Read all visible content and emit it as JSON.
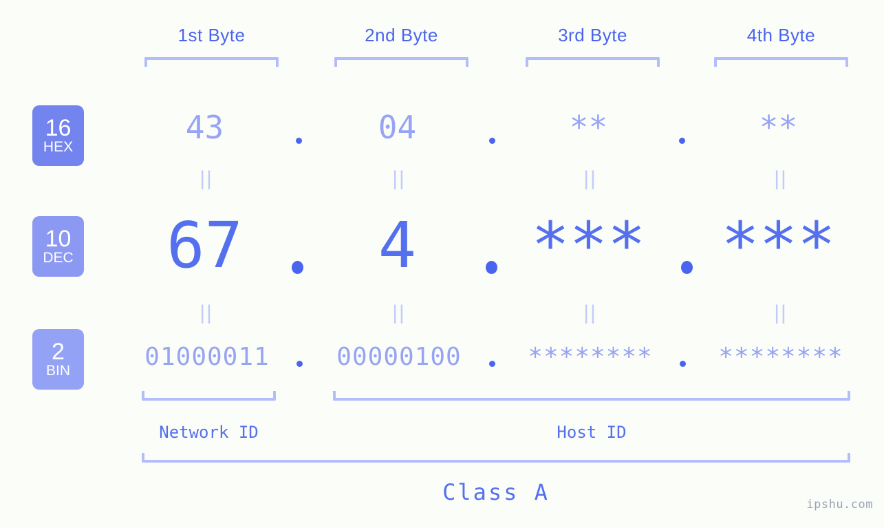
{
  "page": {
    "background_color": "#fbfdf8",
    "accent_color": "#4a64ef",
    "accent_light_color": "#97a4f4",
    "bracket_color": "#b4bdfb",
    "watermark": "ipshu.com"
  },
  "byte_headers": [
    {
      "label": "1st Byte"
    },
    {
      "label": "2nd Byte"
    },
    {
      "label": "3rd Byte"
    },
    {
      "label": "4th Byte"
    }
  ],
  "bases": [
    {
      "number": "16",
      "name": "HEX",
      "color": "#7484ef"
    },
    {
      "number": "10",
      "name": "DEC",
      "color": "#8c99f2"
    },
    {
      "number": "2",
      "name": "BIN",
      "color": "#93a2f5"
    }
  ],
  "rows": {
    "hex": {
      "values": [
        "43",
        "04",
        "**",
        "**"
      ]
    },
    "dec": {
      "values": [
        "67",
        "4",
        "***",
        "***"
      ]
    },
    "bin": {
      "values": [
        "01000011",
        "00000100",
        "********",
        "********"
      ]
    }
  },
  "separators": {
    "glyph": ".",
    "equivalence_glyph": "||"
  },
  "regions": [
    {
      "label": "Network ID"
    },
    {
      "label": "Host ID"
    }
  ],
  "class": {
    "label": "Class A"
  }
}
